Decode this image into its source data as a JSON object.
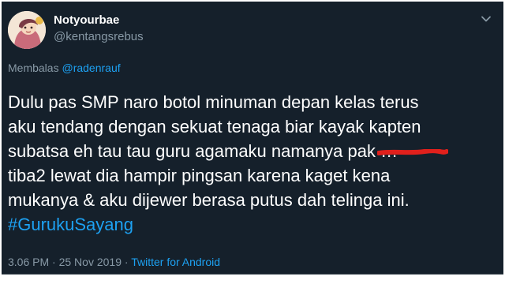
{
  "user": {
    "display_name": "Notyourbae",
    "handle": "@kentangsrebus",
    "avatar_icon": "cartoon-avatar-icon"
  },
  "reply": {
    "prefix": "Membalas",
    "mention": "@radenrauf"
  },
  "tweet": {
    "lines": [
      "Dulu pas SMP naro botol minuman depan kelas terus",
      "aku tendang dengan sekuat tenaga biar kayak kapten",
      "subatsa eh tau tau guru agamaku namanya pak",
      "tiba2 lewat dia hampir pingsan karena kaget kena",
      "mukanya & aku dijewer berasa putus dah telinga ini."
    ],
    "redacted_fragment": "…",
    "hashtag": "#GurukuSayang"
  },
  "meta": {
    "time": "3.06 PM",
    "date": "25 Nov 2019",
    "separator": "·",
    "source": "Twitter for Android"
  },
  "colors": {
    "background": "#15202b",
    "text": "#ffffff",
    "secondary": "#8899a6",
    "link": "#1da1f2",
    "redaction": "#e0201c"
  },
  "icons": {
    "menu": "chevron-down-icon"
  }
}
